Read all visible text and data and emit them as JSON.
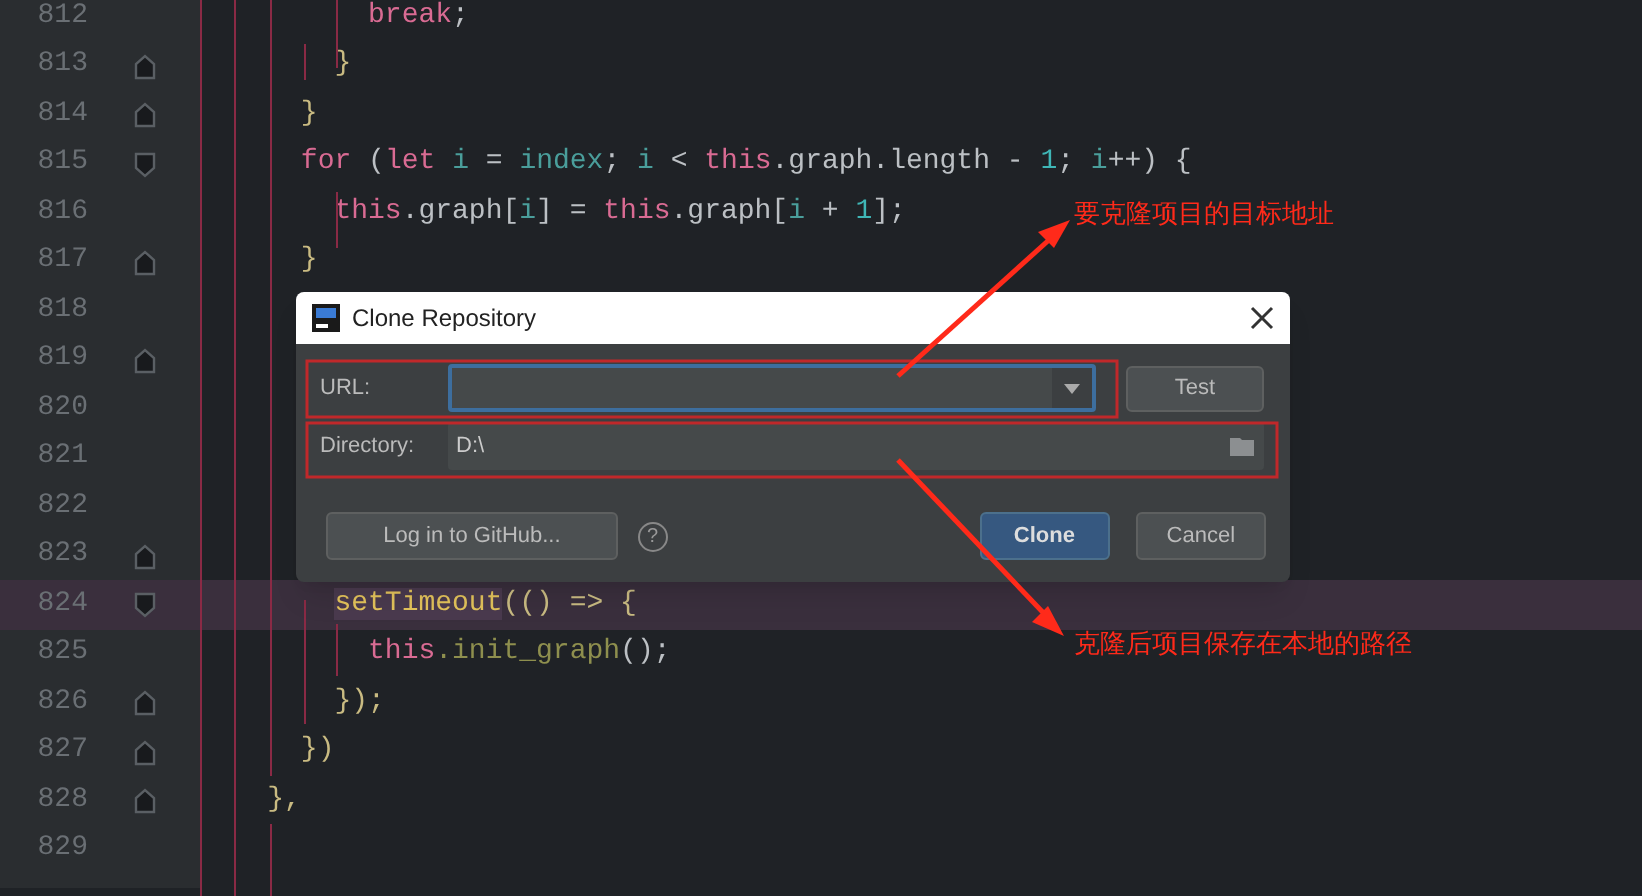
{
  "editor": {
    "lines": [
      {
        "number": "812",
        "highlighted": false,
        "fold_start": false,
        "fold_end": false,
        "tokens": [
          {
            "kind": "keyword",
            "text": "          break"
          },
          {
            "kind": "plain",
            "text": ";"
          }
        ]
      },
      {
        "number": "813",
        "highlighted": false,
        "fold_start": false,
        "fold_end": true,
        "tokens": [
          {
            "kind": "brace",
            "text": "        }"
          }
        ]
      },
      {
        "number": "814",
        "highlighted": false,
        "fold_start": false,
        "fold_end": true,
        "tokens": [
          {
            "kind": "brace",
            "text": "      }"
          }
        ]
      },
      {
        "number": "815",
        "highlighted": false,
        "fold_start": true,
        "fold_end": false,
        "tokens": [
          {
            "kind": "keyword",
            "text": "      for"
          },
          {
            "kind": "plain",
            "text": " ("
          },
          {
            "kind": "keyword",
            "text": "let"
          },
          {
            "kind": "variable",
            "text": " i"
          },
          {
            "kind": "plain",
            "text": " = "
          },
          {
            "kind": "variable",
            "text": "index"
          },
          {
            "kind": "plain",
            "text": "; "
          },
          {
            "kind": "variable",
            "text": "i"
          },
          {
            "kind": "plain",
            "text": " < "
          },
          {
            "kind": "keyword",
            "text": "this"
          },
          {
            "kind": "plain",
            "text": ".graph.length - "
          },
          {
            "kind": "number",
            "text": "1"
          },
          {
            "kind": "plain",
            "text": "; "
          },
          {
            "kind": "variable",
            "text": "i"
          },
          {
            "kind": "plain",
            "text": "++) {"
          }
        ]
      },
      {
        "number": "816",
        "highlighted": false,
        "fold_start": false,
        "fold_end": false,
        "tokens": [
          {
            "kind": "keyword",
            "text": "        this"
          },
          {
            "kind": "plain",
            "text": ".graph["
          },
          {
            "kind": "variable",
            "text": "i"
          },
          {
            "kind": "plain",
            "text": "] = "
          },
          {
            "kind": "keyword",
            "text": "this"
          },
          {
            "kind": "plain",
            "text": ".graph["
          },
          {
            "kind": "variable",
            "text": "i"
          },
          {
            "kind": "plain",
            "text": " + "
          },
          {
            "kind": "number",
            "text": "1"
          },
          {
            "kind": "plain",
            "text": "];"
          }
        ]
      },
      {
        "number": "817",
        "highlighted": false,
        "fold_start": false,
        "fold_end": true,
        "tokens": [
          {
            "kind": "brace",
            "text": "      }"
          }
        ]
      },
      {
        "number": "818",
        "highlighted": false,
        "fold_start": false,
        "fold_end": false
      },
      {
        "number": "819",
        "highlighted": false,
        "fold_start": false,
        "fold_end": true
      },
      {
        "number": "820",
        "highlighted": false,
        "fold_start": false,
        "fold_end": false
      },
      {
        "number": "821",
        "highlighted": false,
        "fold_start": false,
        "fold_end": false
      },
      {
        "number": "822",
        "highlighted": false,
        "fold_start": false,
        "fold_end": false
      },
      {
        "number": "823",
        "highlighted": false,
        "fold_start": false,
        "fold_end": true
      },
      {
        "number": "824",
        "highlighted": true,
        "fold_start": true,
        "fold_end": false,
        "tokens": [
          {
            "kind": "call",
            "text": "        setTimeout"
          },
          {
            "kind": "brace",
            "text": "(() => {"
          }
        ]
      },
      {
        "number": "825",
        "highlighted": false,
        "fold_start": false,
        "fold_end": false,
        "tokens": [
          {
            "kind": "keyword",
            "text": "          this"
          },
          {
            "kind": "method",
            "text": ".init_graph"
          },
          {
            "kind": "plain",
            "text": "();"
          }
        ]
      },
      {
        "number": "826",
        "highlighted": false,
        "fold_start": false,
        "fold_end": true,
        "tokens": [
          {
            "kind": "brace",
            "text": "        });"
          }
        ]
      },
      {
        "number": "827",
        "highlighted": false,
        "fold_start": false,
        "fold_end": true,
        "tokens": [
          {
            "kind": "brace",
            "text": "      })"
          }
        ]
      },
      {
        "number": "828",
        "highlighted": false,
        "fold_start": false,
        "fold_end": true,
        "tokens": [
          {
            "kind": "brace",
            "text": "    },"
          }
        ]
      },
      {
        "number": "829",
        "highlighted": false,
        "fold_start": false,
        "fold_end": false
      }
    ]
  },
  "dialog": {
    "title": "Clone Repository",
    "url": {
      "label": "URL:",
      "focused": true
    },
    "test_button": "Test",
    "directory": {
      "label": "Directory:",
      "value": "D:\\"
    },
    "github_button": "Log in to GitHub...",
    "help": "?",
    "clone_button": "Clone",
    "cancel_button": "Cancel"
  },
  "annotations": [
    {
      "text": "要克隆项目的目标地址"
    },
    {
      "text": "克隆后项目保存在本地的路径"
    }
  ]
}
